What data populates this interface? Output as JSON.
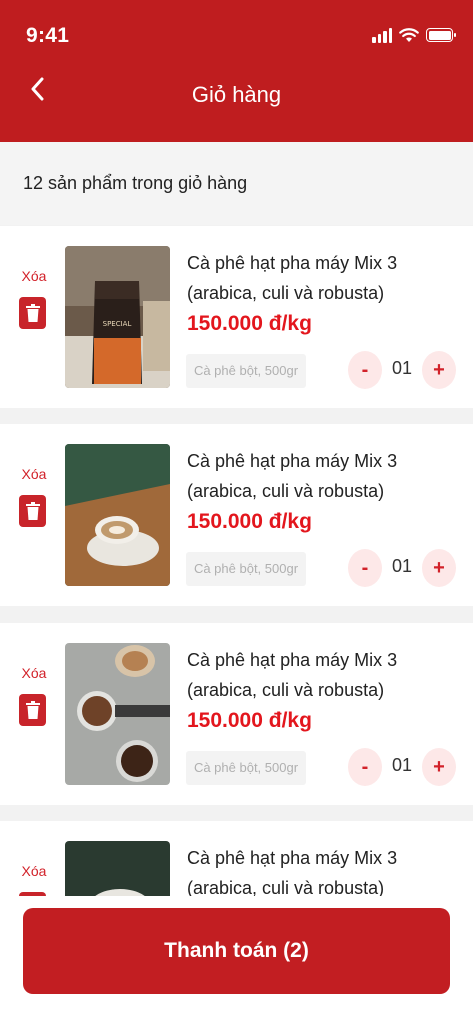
{
  "status_bar": {
    "time": "9:41"
  },
  "header": {
    "title": "Giỏ hàng"
  },
  "summary": {
    "text": "12 sản phẩm trong giỏ hàng"
  },
  "items": [
    {
      "delete_label": "Xóa",
      "name": "Cà phê hạt pha máy Mix 3 (arabica, culi và robusta)",
      "price": "150.000 đ/kg",
      "variant": "Cà phê bột, 500gr",
      "qty": "01",
      "minus": "-",
      "plus": "+"
    },
    {
      "delete_label": "Xóa",
      "name": "Cà phê hạt pha máy Mix 3 (arabica, culi và robusta)",
      "price": "150.000 đ/kg",
      "variant": "Cà phê bột, 500gr",
      "qty": "01",
      "minus": "-",
      "plus": "+"
    },
    {
      "delete_label": "Xóa",
      "name": "Cà phê hạt pha máy Mix 3 (arabica, culi và robusta)",
      "price": "150.000 đ/kg",
      "variant": "Cà phê bột, 500gr",
      "qty": "01",
      "minus": "-",
      "plus": "+"
    },
    {
      "delete_label": "Xóa",
      "name": "Cà phê hạt pha máy Mix 3 (arabica, culi và robusta)"
    }
  ],
  "checkout": {
    "label": "Thanh toán (2)"
  },
  "colors": {
    "brand": "#bf1d1f",
    "price": "#e3161d",
    "qty_bg": "#fde8e8"
  },
  "icons": [
    "chevron-left-icon",
    "signal-icon",
    "wifi-icon",
    "battery-icon",
    "trash-icon"
  ]
}
